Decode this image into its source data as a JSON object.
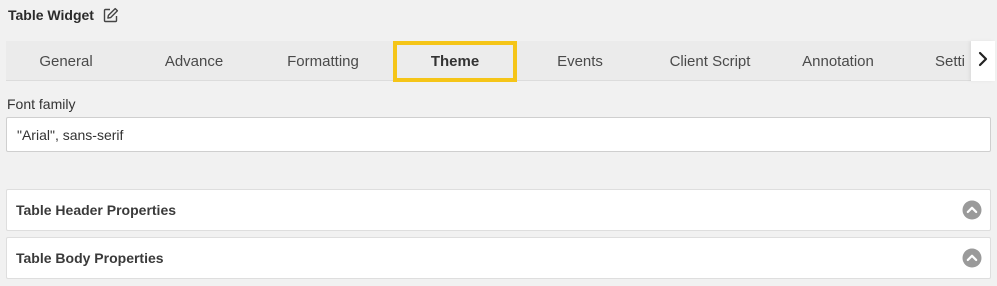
{
  "header": {
    "title": "Table Widget",
    "edit_icon": "edit-pencil-icon"
  },
  "tabs": [
    {
      "label": "General",
      "active": false
    },
    {
      "label": "Advance",
      "active": false
    },
    {
      "label": "Formatting",
      "active": false
    },
    {
      "label": "Theme",
      "active": true
    },
    {
      "label": "Events",
      "active": false
    },
    {
      "label": "Client Script",
      "active": false
    },
    {
      "label": "Annotation",
      "active": false
    },
    {
      "label": "Setti",
      "active": false
    }
  ],
  "tabs_scroll_icon": "chevron-right-icon",
  "font_family": {
    "label": "Font family",
    "value": "\"Arial\", sans-serif"
  },
  "panels": [
    {
      "title": "Table Header Properties",
      "icon": "chevron-up-circle-icon"
    },
    {
      "title": "Table Body Properties",
      "icon": "chevron-up-circle-icon"
    }
  ],
  "colors": {
    "active_tab_border": "#f5c518",
    "background": "#f1f1f1",
    "collapse_icon": "#9a9a9a"
  }
}
